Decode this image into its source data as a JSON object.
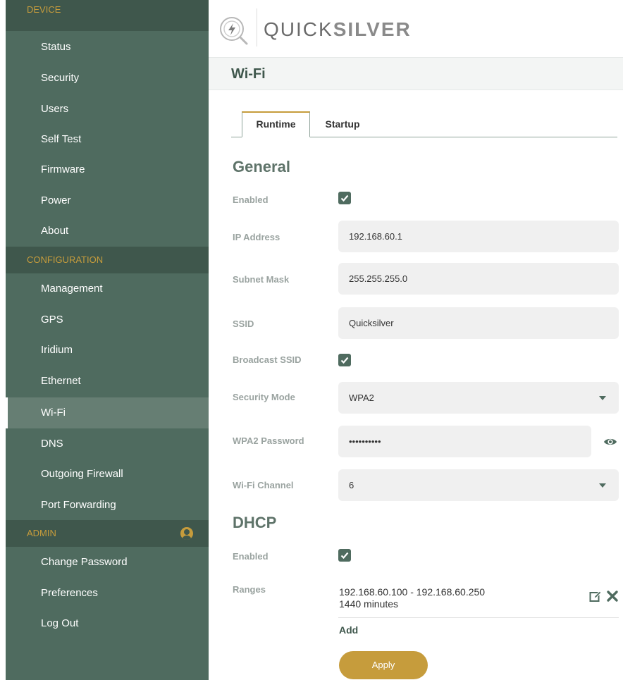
{
  "brand": {
    "name_light": "QUICK",
    "name_bold": "SILVER"
  },
  "page": {
    "title": "Wi-Fi"
  },
  "sidebar": {
    "sections": [
      {
        "header": "DEVICE",
        "items": [
          "Status",
          "Security",
          "Users",
          "Self Test",
          "Firmware",
          "Power",
          "About"
        ]
      },
      {
        "header": "CONFIGURATION",
        "items": [
          "Management",
          "GPS",
          "Iridium",
          "Ethernet",
          "Wi-Fi",
          "DNS",
          "Outgoing Firewall",
          "Port Forwarding"
        ]
      },
      {
        "header": "ADMIN",
        "items": [
          "Change Password",
          "Preferences",
          "Log Out"
        ]
      }
    ],
    "active_item": "Wi-Fi"
  },
  "tabs": {
    "runtime": "Runtime",
    "startup": "Startup",
    "active": "Runtime"
  },
  "general": {
    "title": "General",
    "enabled": {
      "label": "Enabled",
      "checked": true
    },
    "ip_address": {
      "label": "IP Address",
      "value": "192.168.60.1"
    },
    "subnet_mask": {
      "label": "Subnet Mask",
      "value": "255.255.255.0"
    },
    "ssid": {
      "label": "SSID",
      "value": "Quicksilver"
    },
    "broadcast_ssid": {
      "label": "Broadcast SSID",
      "checked": true
    },
    "security_mode": {
      "label": "Security Mode",
      "value": "WPA2"
    },
    "wpa2_password": {
      "label": "WPA2 Password",
      "value": "••••••••••"
    },
    "wifi_channel": {
      "label": "Wi-Fi Channel",
      "value": "6"
    }
  },
  "dhcp": {
    "title": "DHCP",
    "enabled": {
      "label": "Enabled",
      "checked": true
    },
    "ranges": {
      "label": "Ranges",
      "items": [
        {
          "range": "192.168.60.100 - 192.168.60.250",
          "lease": "1440 minutes"
        }
      ],
      "add_label": "Add"
    }
  },
  "apply_label": "Apply",
  "icons": {
    "logo": "lightning-logo-icon",
    "user": "user-circle-icon",
    "eye": "eye-icon",
    "edit": "edit-icon",
    "delete": "close-icon",
    "dropdown": "caret-down-icon",
    "check": "check-icon"
  },
  "colors": {
    "sidebar_bg": "#4f6b5f",
    "sidebar_header_bg": "#3f574c",
    "accent_gold": "#c69c3c",
    "title_green": "#3f574c"
  }
}
